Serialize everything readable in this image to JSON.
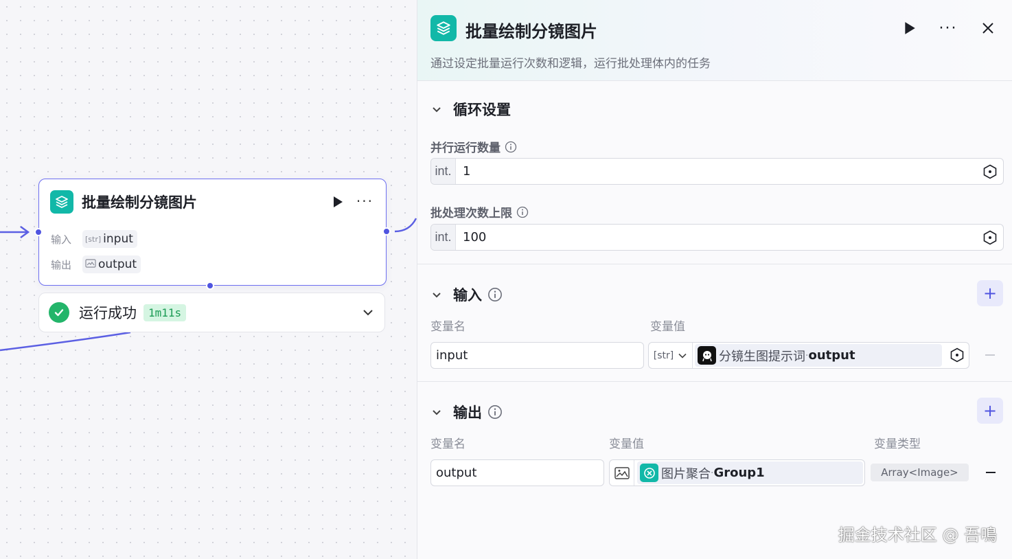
{
  "node": {
    "title": "批量绘制分镜图片",
    "input_label": "输入",
    "input_tag": "[str]",
    "input_value": "input",
    "output_label": "输出",
    "output_value": "output"
  },
  "status": {
    "text": "运行成功",
    "duration": "1m11s"
  },
  "panel": {
    "title": "批量绘制分镜图片",
    "description": "通过设定批量运行次数和逻辑，运行批处理体内的任务",
    "loop_section": {
      "title": "循环设置",
      "parallel_label": "并行运行数量",
      "parallel_type": "int.",
      "parallel_value": "1",
      "batch_label": "批处理次数上限",
      "batch_type": "int.",
      "batch_value": "100"
    },
    "input_section": {
      "title": "输入",
      "col_name": "变量名",
      "col_value": "变量值",
      "var_name": "input",
      "var_type": "[str]",
      "ref_source": "分镜生图提示词",
      "ref_sep": " · ",
      "ref_field": "output"
    },
    "output_section": {
      "title": "输出",
      "col_name": "变量名",
      "col_value": "变量值",
      "col_type": "变量类型",
      "var_name": "output",
      "ref_source": "图片聚合",
      "ref_sep": " · ",
      "ref_field": "Group1",
      "var_type": "Array<Image>"
    }
  },
  "watermark": "掘金技术社区 @ 吾鳴",
  "colors": {
    "accent": "#4f54e0",
    "teal": "#12b8a8",
    "success": "#23b56a"
  }
}
